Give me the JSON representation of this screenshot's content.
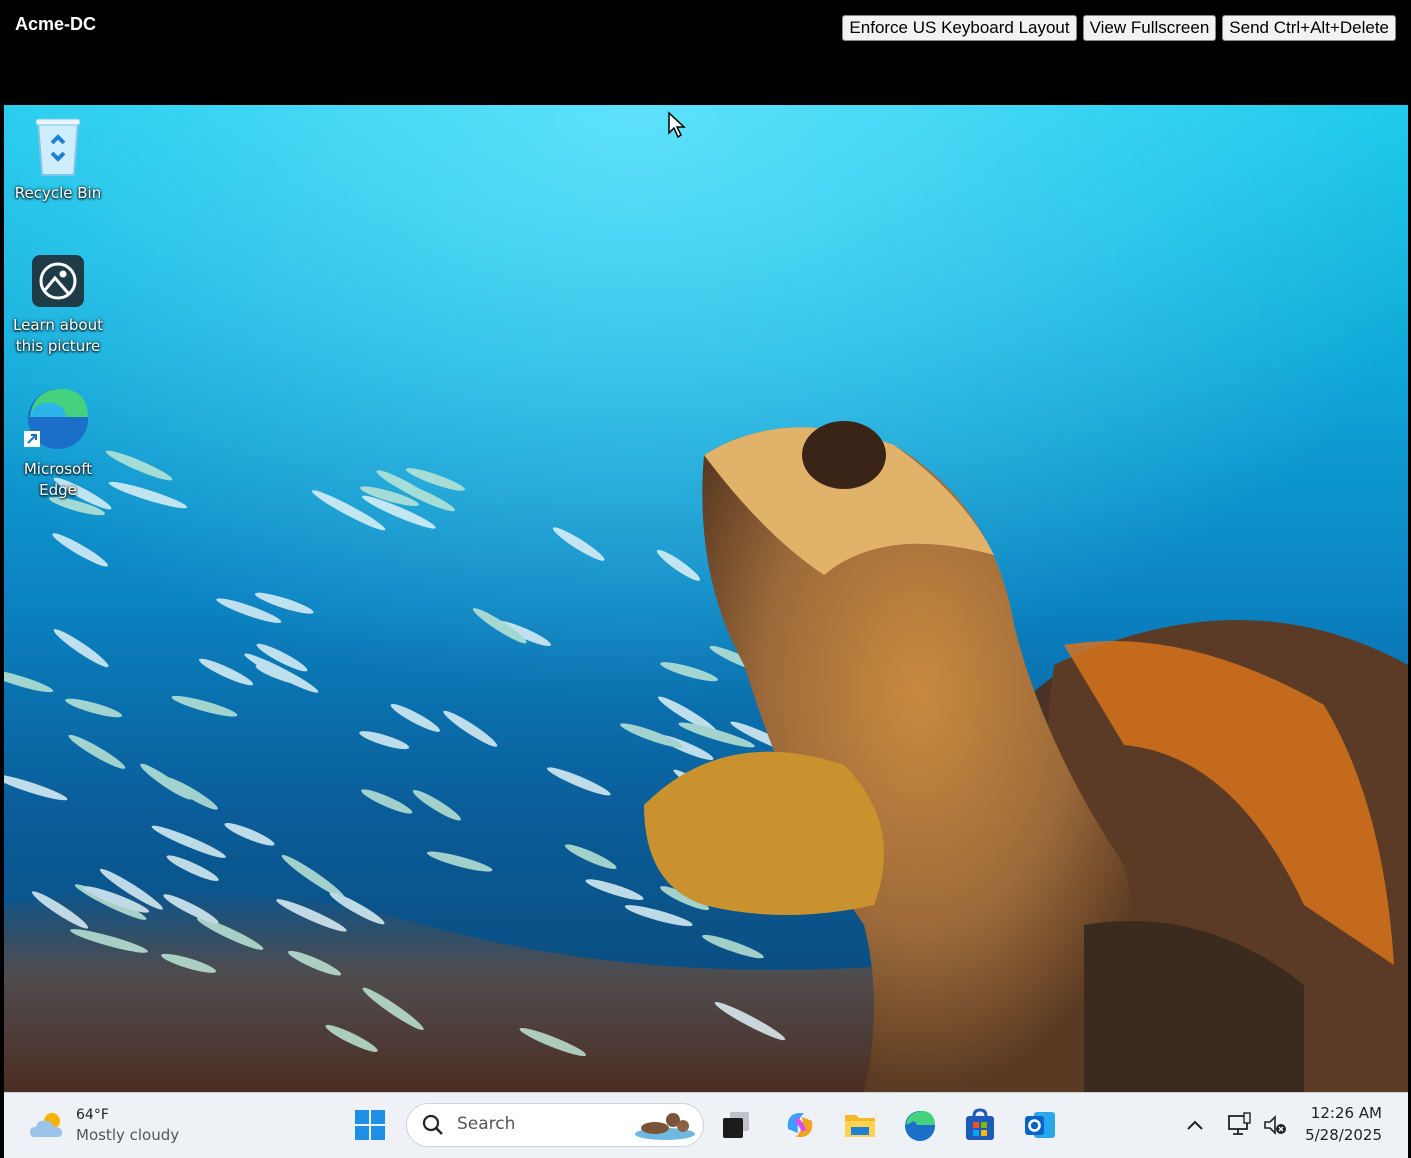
{
  "host": {
    "title": "Acme-DC",
    "buttons": [
      "Enforce US Keyboard Layout",
      "View Fullscreen",
      "Send Ctrl+Alt+Delete"
    ]
  },
  "desktop_icons": [
    {
      "label": "Recycle Bin",
      "icon": "recycle-bin-icon"
    },
    {
      "label": "Learn about this picture",
      "icon": "learn-about-picture-icon"
    },
    {
      "label": "Microsoft Edge",
      "icon": "edge-icon"
    }
  ],
  "taskbar": {
    "weather": {
      "temp": "64°F",
      "condition": "Mostly cloudy"
    },
    "search_placeholder": "Search",
    "pinned": [
      "start-icon",
      "task-view-icon",
      "copilot-icon",
      "file-explorer-icon",
      "edge-icon",
      "store-icon",
      "outlook-icon"
    ],
    "clock": {
      "time": "12:26 AM",
      "date": "5/28/2025"
    }
  },
  "colors": {
    "taskbar_bg": "#eef1f6",
    "ocean_top": "#19c8ea",
    "ocean_bottom": "#0a4572"
  }
}
